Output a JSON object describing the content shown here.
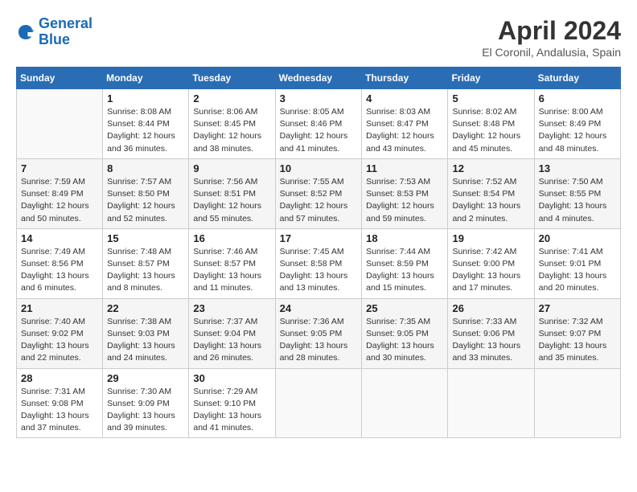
{
  "header": {
    "logo_line1": "General",
    "logo_line2": "Blue",
    "title": "April 2024",
    "subtitle": "El Coronil, Andalusia, Spain"
  },
  "columns": [
    "Sunday",
    "Monday",
    "Tuesday",
    "Wednesday",
    "Thursday",
    "Friday",
    "Saturday"
  ],
  "weeks": [
    [
      {
        "day": "",
        "info": ""
      },
      {
        "day": "1",
        "info": "Sunrise: 8:08 AM\nSunset: 8:44 PM\nDaylight: 12 hours\nand 36 minutes."
      },
      {
        "day": "2",
        "info": "Sunrise: 8:06 AM\nSunset: 8:45 PM\nDaylight: 12 hours\nand 38 minutes."
      },
      {
        "day": "3",
        "info": "Sunrise: 8:05 AM\nSunset: 8:46 PM\nDaylight: 12 hours\nand 41 minutes."
      },
      {
        "day": "4",
        "info": "Sunrise: 8:03 AM\nSunset: 8:47 PM\nDaylight: 12 hours\nand 43 minutes."
      },
      {
        "day": "5",
        "info": "Sunrise: 8:02 AM\nSunset: 8:48 PM\nDaylight: 12 hours\nand 45 minutes."
      },
      {
        "day": "6",
        "info": "Sunrise: 8:00 AM\nSunset: 8:49 PM\nDaylight: 12 hours\nand 48 minutes."
      }
    ],
    [
      {
        "day": "7",
        "info": "Sunrise: 7:59 AM\nSunset: 8:49 PM\nDaylight: 12 hours\nand 50 minutes."
      },
      {
        "day": "8",
        "info": "Sunrise: 7:57 AM\nSunset: 8:50 PM\nDaylight: 12 hours\nand 52 minutes."
      },
      {
        "day": "9",
        "info": "Sunrise: 7:56 AM\nSunset: 8:51 PM\nDaylight: 12 hours\nand 55 minutes."
      },
      {
        "day": "10",
        "info": "Sunrise: 7:55 AM\nSunset: 8:52 PM\nDaylight: 12 hours\nand 57 minutes."
      },
      {
        "day": "11",
        "info": "Sunrise: 7:53 AM\nSunset: 8:53 PM\nDaylight: 12 hours\nand 59 minutes."
      },
      {
        "day": "12",
        "info": "Sunrise: 7:52 AM\nSunset: 8:54 PM\nDaylight: 13 hours\nand 2 minutes."
      },
      {
        "day": "13",
        "info": "Sunrise: 7:50 AM\nSunset: 8:55 PM\nDaylight: 13 hours\nand 4 minutes."
      }
    ],
    [
      {
        "day": "14",
        "info": "Sunrise: 7:49 AM\nSunset: 8:56 PM\nDaylight: 13 hours\nand 6 minutes."
      },
      {
        "day": "15",
        "info": "Sunrise: 7:48 AM\nSunset: 8:57 PM\nDaylight: 13 hours\nand 8 minutes."
      },
      {
        "day": "16",
        "info": "Sunrise: 7:46 AM\nSunset: 8:57 PM\nDaylight: 13 hours\nand 11 minutes."
      },
      {
        "day": "17",
        "info": "Sunrise: 7:45 AM\nSunset: 8:58 PM\nDaylight: 13 hours\nand 13 minutes."
      },
      {
        "day": "18",
        "info": "Sunrise: 7:44 AM\nSunset: 8:59 PM\nDaylight: 13 hours\nand 15 minutes."
      },
      {
        "day": "19",
        "info": "Sunrise: 7:42 AM\nSunset: 9:00 PM\nDaylight: 13 hours\nand 17 minutes."
      },
      {
        "day": "20",
        "info": "Sunrise: 7:41 AM\nSunset: 9:01 PM\nDaylight: 13 hours\nand 20 minutes."
      }
    ],
    [
      {
        "day": "21",
        "info": "Sunrise: 7:40 AM\nSunset: 9:02 PM\nDaylight: 13 hours\nand 22 minutes."
      },
      {
        "day": "22",
        "info": "Sunrise: 7:38 AM\nSunset: 9:03 PM\nDaylight: 13 hours\nand 24 minutes."
      },
      {
        "day": "23",
        "info": "Sunrise: 7:37 AM\nSunset: 9:04 PM\nDaylight: 13 hours\nand 26 minutes."
      },
      {
        "day": "24",
        "info": "Sunrise: 7:36 AM\nSunset: 9:05 PM\nDaylight: 13 hours\nand 28 minutes."
      },
      {
        "day": "25",
        "info": "Sunrise: 7:35 AM\nSunset: 9:05 PM\nDaylight: 13 hours\nand 30 minutes."
      },
      {
        "day": "26",
        "info": "Sunrise: 7:33 AM\nSunset: 9:06 PM\nDaylight: 13 hours\nand 33 minutes."
      },
      {
        "day": "27",
        "info": "Sunrise: 7:32 AM\nSunset: 9:07 PM\nDaylight: 13 hours\nand 35 minutes."
      }
    ],
    [
      {
        "day": "28",
        "info": "Sunrise: 7:31 AM\nSunset: 9:08 PM\nDaylight: 13 hours\nand 37 minutes."
      },
      {
        "day": "29",
        "info": "Sunrise: 7:30 AM\nSunset: 9:09 PM\nDaylight: 13 hours\nand 39 minutes."
      },
      {
        "day": "30",
        "info": "Sunrise: 7:29 AM\nSunset: 9:10 PM\nDaylight: 13 hours\nand 41 minutes."
      },
      {
        "day": "",
        "info": ""
      },
      {
        "day": "",
        "info": ""
      },
      {
        "day": "",
        "info": ""
      },
      {
        "day": "",
        "info": ""
      }
    ]
  ]
}
